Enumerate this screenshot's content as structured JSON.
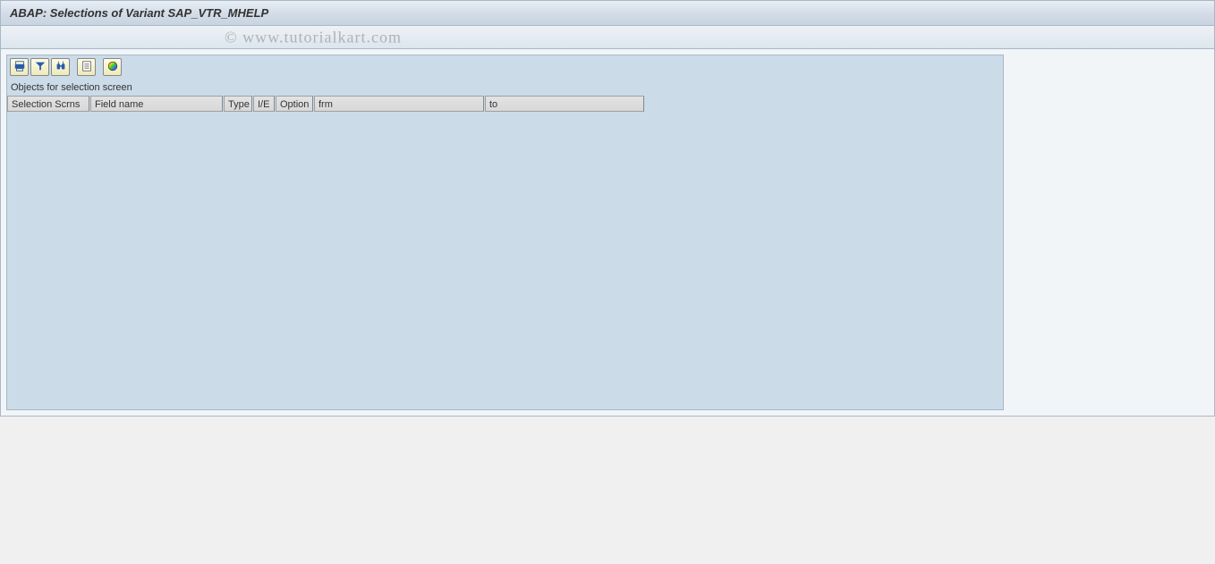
{
  "header": {
    "title": "ABAP: Selections of Variant SAP_VTR_MHELP"
  },
  "watermark": "© www.tutorialkart.com",
  "toolbar": {
    "buttons": [
      {
        "name": "print-icon"
      },
      {
        "name": "filter-icon"
      },
      {
        "name": "save-icon"
      },
      {
        "name": "export-icon"
      },
      {
        "name": "layout-icon"
      }
    ]
  },
  "section": {
    "label": "Objects for selection screen"
  },
  "table": {
    "columns": {
      "sel_scrns": "Selection Scrns",
      "field_name": "Field name",
      "type": "Type",
      "ie": "I/E",
      "option": "Option",
      "frm": "frm",
      "to": "to"
    },
    "rows": []
  }
}
